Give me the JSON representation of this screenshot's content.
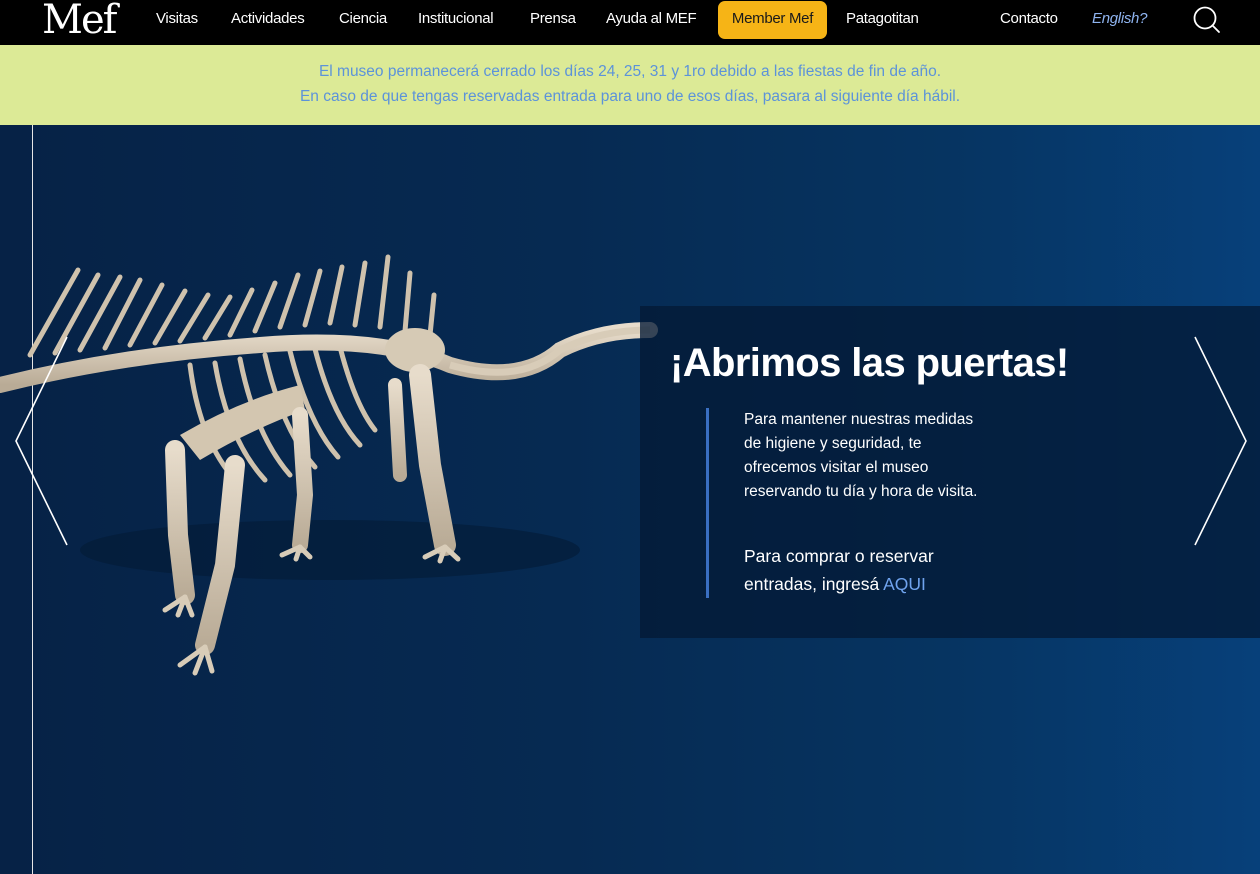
{
  "header": {
    "logo": "Mef",
    "nav": {
      "visitas": "Visitas",
      "actividades": "Actividades",
      "ciencia": "Ciencia",
      "institucional": "Institucional",
      "prensa": "Prensa",
      "ayuda": "Ayuda al MEF",
      "member": "Member Mef",
      "patagotitan": "Patagotitan",
      "contacto": "Contacto",
      "english": "English?"
    },
    "icons": {
      "search": "search-icon"
    },
    "colors": {
      "member_bg": "#f6b416",
      "english": "#8fb4f0"
    }
  },
  "notice": {
    "line1": "El museo permanecerá cerrado los días 24, 25, 31 y 1ro debido a las fiestas de fin de año.",
    "line2": "En caso de que tengas reservadas entrada para uno de esos días, pasara al siguiente día hábil.",
    "colors": {
      "bg": "#dcea96",
      "text": "#5c93d9"
    }
  },
  "hero": {
    "title": "¡Abrimos las puertas!",
    "paragraph1": "Para mantener nuestras medidas de higiene y seguridad, te ofrecemos visitar el museo reservando tu día y hora de visita.",
    "paragraph2_prefix": "Para comprar o reservar entradas, ingresá ",
    "link_label": "AQUI",
    "icons": {
      "prev": "chevron-left-icon",
      "next": "chevron-right-icon",
      "image": "dinosaur-skeleton-image"
    },
    "colors": {
      "bg": "#062a52",
      "accent_bar": "#3a6fc2",
      "link": "#6fa3ee"
    }
  }
}
